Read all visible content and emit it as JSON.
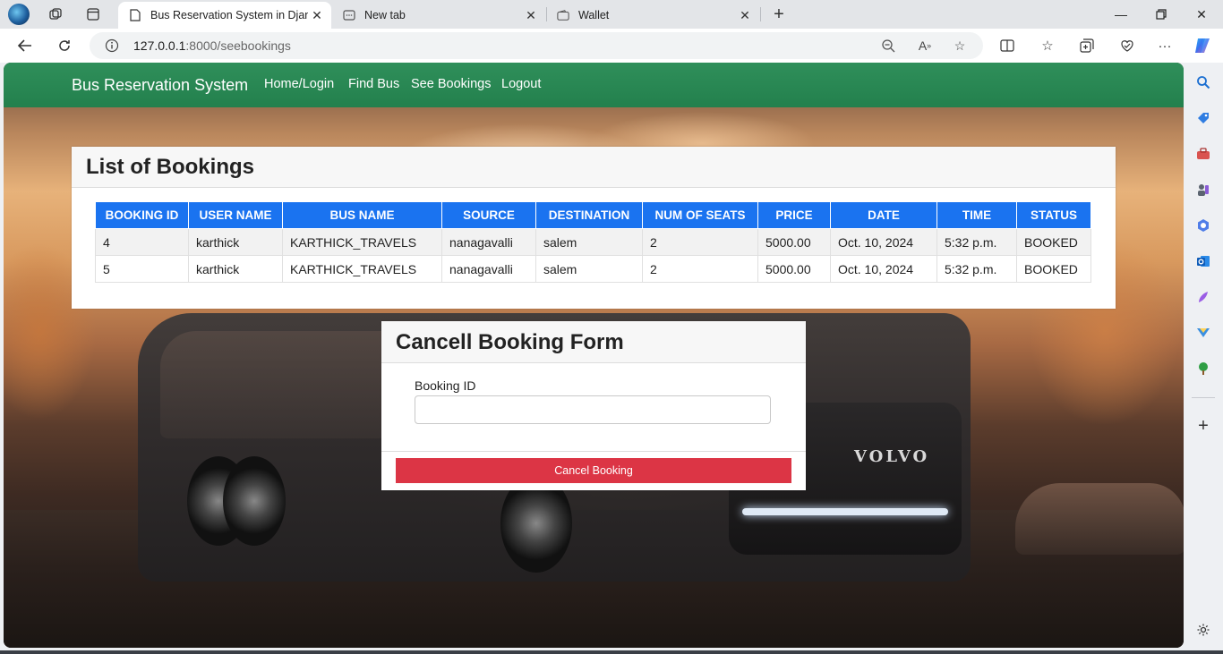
{
  "browser": {
    "tabs": [
      {
        "title": "Bus Reservation System in Djang",
        "active": true
      },
      {
        "title": "New tab",
        "active": false
      },
      {
        "title": "Wallet",
        "active": false
      }
    ],
    "url_host": "127.0.0.1",
    "url_rest": ":8000/seebookings",
    "accent": "#1a73f0"
  },
  "app": {
    "brand": "Bus Reservation System",
    "nav": [
      "Home/Login",
      "Find Bus",
      "See Bookings",
      "Logout"
    ],
    "nav_color": "#2e8b57"
  },
  "bookings": {
    "title": "List of Bookings",
    "columns": [
      "BOOKING ID",
      "USER NAME",
      "BUS NAME",
      "SOURCE",
      "DESTINATION",
      "NUM OF SEATS",
      "PRICE",
      "DATE",
      "TIME",
      "STATUS"
    ],
    "rows": [
      [
        "4",
        "karthick",
        "KARTHICK_TRAVELS",
        "nanagavalli",
        "salem",
        "2",
        "5000.00",
        "Oct. 10, 2024",
        "5:32 p.m.",
        "BOOKED"
      ],
      [
        "5",
        "karthick",
        "KARTHICK_TRAVELS",
        "nanagavalli",
        "salem",
        "2",
        "5000.00",
        "Oct. 10, 2024",
        "5:32 p.m.",
        "BOOKED"
      ]
    ]
  },
  "cancel_form": {
    "title": "Cancell Booking Form",
    "field_label": "Booking ID",
    "field_value": "",
    "button_label": "Cancel Booking",
    "button_color": "#dc3545"
  },
  "scene": {
    "bus_brand": "VOLVO"
  }
}
